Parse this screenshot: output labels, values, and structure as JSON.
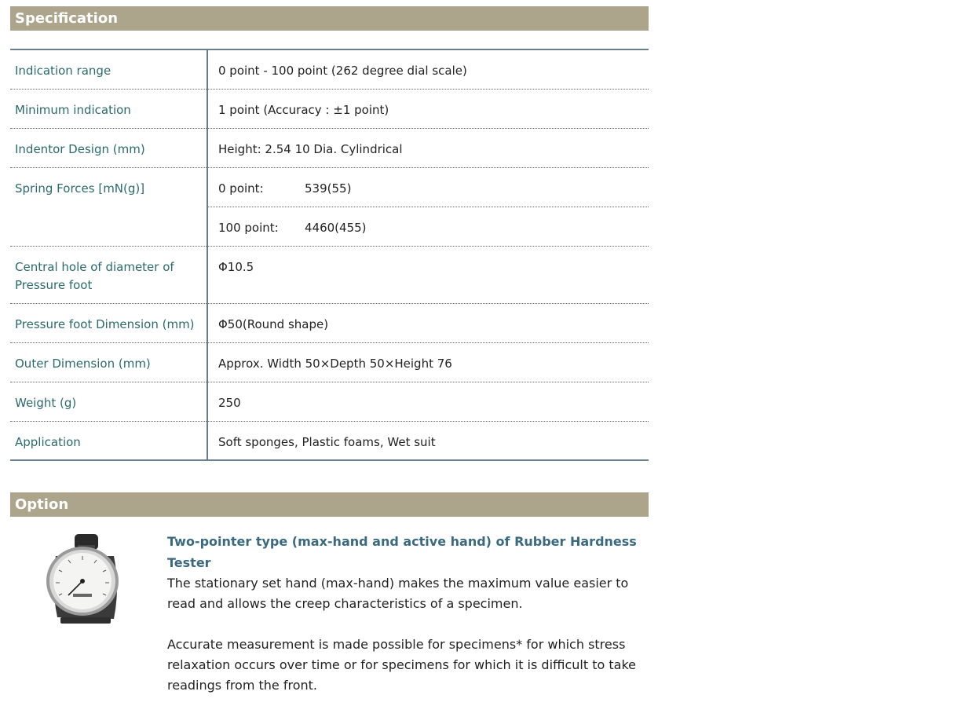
{
  "specification": {
    "heading": "Specification",
    "rows": [
      {
        "label": "Indication range",
        "value": "0 point - 100 point (262 degree dial scale)"
      },
      {
        "label": "Minimum indication",
        "value": "1 point (Accuracy : ±1 point)"
      },
      {
        "label": "Indentor Design (mm)",
        "value": "Height: 2.54 10 Dia. Cylindrical"
      },
      {
        "label": "Spring Forces [mN(g)]",
        "subrows": [
          {
            "key": "0 point:",
            "value": "539(55)"
          },
          {
            "key": "100 point:",
            "value": "4460(455)"
          }
        ]
      },
      {
        "label": "Central hole of diameter of Pressure foot",
        "value": "Φ10.5"
      },
      {
        "label": "Pressure foot Dimension (mm)",
        "value": "Φ50(Round shape)"
      },
      {
        "label": "Outer Dimension (mm)",
        "value": "Approx. Width 50×Depth 50×Height 76"
      },
      {
        "label": "Weight (g)",
        "value": "250"
      },
      {
        "label": "Application",
        "value": "Soft sponges, Plastic foams, Wet suit"
      }
    ]
  },
  "option": {
    "heading": "Option",
    "image_icon": "rubber-hardness-tester-image",
    "title": "Two-pointer type (max-hand and active hand) of Rubber Hardness Tester",
    "paragraphs": [
      "The stationary set hand (max-hand) makes the maximum value easier to read and allows the creep characteristics of a specimen.",
      "Accurate measurement is made possible for specimens* for which stress relaxation occurs over time or for specimens for which it is difficult to take readings from the front."
    ]
  },
  "colors": {
    "header_bg": "#aca58c",
    "label_text": "#2b6a6e",
    "title_text": "#3a6a80",
    "table_rule": "#6b7f8c"
  }
}
